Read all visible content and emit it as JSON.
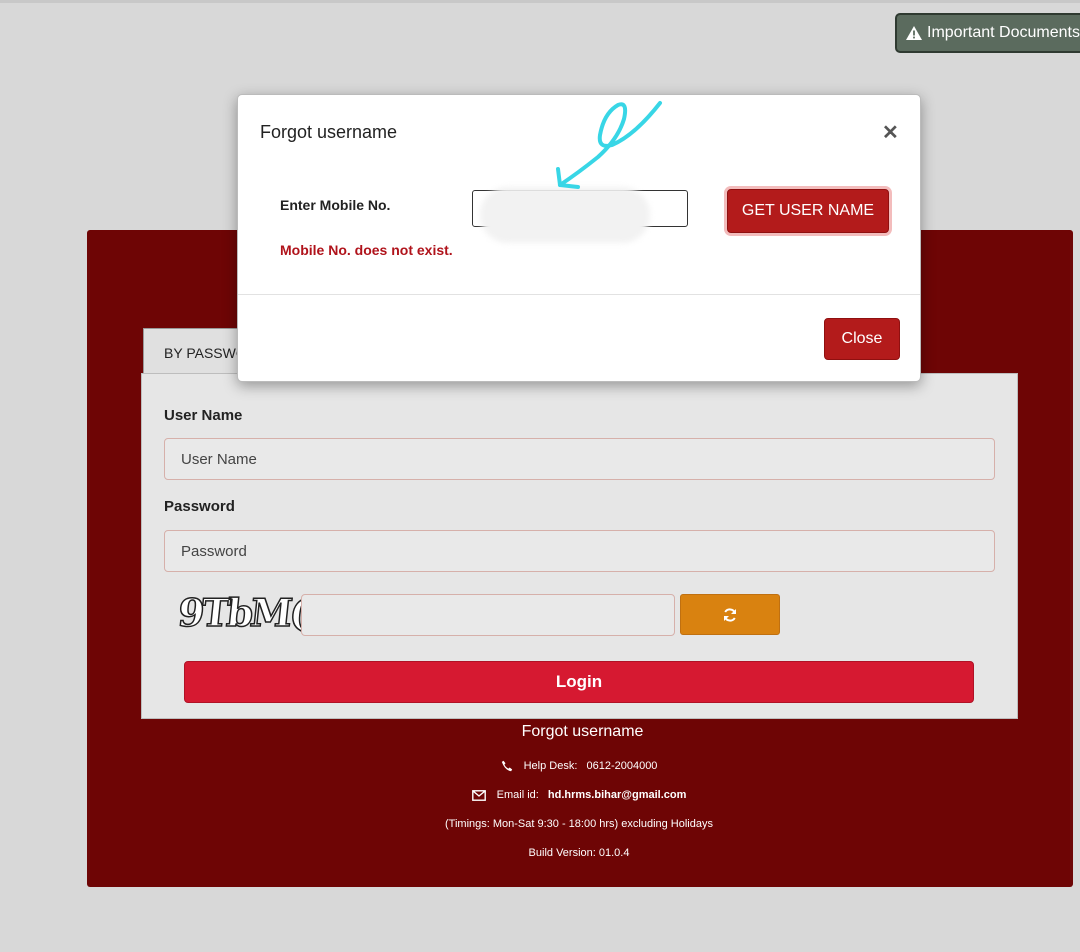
{
  "header": {
    "important_documents_label": "Important Documents",
    "important_documents_icon": "warning-triangle-icon"
  },
  "login": {
    "tab_label": "BY PASSWORD",
    "username_label": "User Name",
    "username_placeholder": "User Name",
    "password_label": "Password",
    "password_placeholder": "Password",
    "captcha_text": "9TbM(",
    "captcha_input_value": "",
    "refresh_icon": "refresh-icon",
    "login_button": "Login",
    "forgot_username_link": "Forgot username"
  },
  "footer": {
    "help_desk_label": "Help Desk:",
    "help_desk_number": "0612-2004000",
    "email_label": "Email id:",
    "email_value": "hd.hrms.bihar@gmail.com",
    "timings": "(Timings: Mon-Sat 9:30 - 18:00 hrs) excluding Holidays",
    "build_version": "Build Version: 01.0.4"
  },
  "modal": {
    "title": "Forgot username",
    "mobile_label": "Enter Mobile No.",
    "mobile_value": "",
    "error_message": "Mobile No. does not exist.",
    "get_username_button": "GET USER NAME",
    "close_button": "Close"
  },
  "colors": {
    "panel": "#6e0505",
    "login_button": "#d61931",
    "refresh_button": "#d98210",
    "modal_button": "#b31b1b",
    "error_text": "#b0131b",
    "annotation_stroke": "#38d6e6"
  }
}
